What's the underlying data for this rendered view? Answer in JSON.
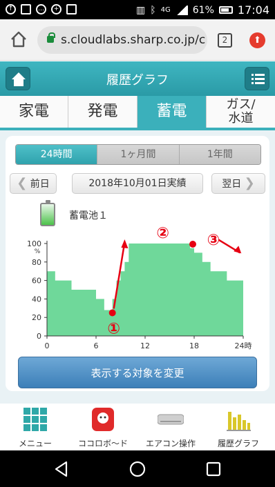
{
  "status_bar": {
    "battery": "61%",
    "time": "17:04",
    "network": "4G"
  },
  "browser": {
    "url": "s.cloudlabs.sharp.co.jp/c",
    "tab_count": "2"
  },
  "header": {
    "title": "履歴グラフ"
  },
  "tabs": [
    {
      "label": "家電",
      "active": false
    },
    {
      "label": "発電",
      "active": false
    },
    {
      "label": "蓄電",
      "active": true
    },
    {
      "label": "ガス/\n水道",
      "active": false
    }
  ],
  "range_tabs": [
    {
      "label": "24時間",
      "active": true
    },
    {
      "label": "1ヶ月間",
      "active": false
    },
    {
      "label": "1年間",
      "active": false
    }
  ],
  "date_nav": {
    "prev": "前日",
    "current": "2018年10月01日実績",
    "next": "翌日"
  },
  "device": {
    "label": "蓄電池１"
  },
  "chart_data": {
    "type": "area",
    "ylabel": "%",
    "ylim": [
      0,
      100
    ],
    "yticks": [
      0,
      20,
      40,
      60,
      80,
      100
    ],
    "xlim": [
      0,
      24
    ],
    "xticks": [
      0,
      6,
      12,
      18,
      24
    ],
    "xtick_labels": [
      "0",
      "6",
      "12",
      "18",
      "24時"
    ],
    "series": [
      {
        "color": "#6fd89a",
        "points": [
          [
            0,
            70
          ],
          [
            1,
            70
          ],
          [
            1,
            60
          ],
          [
            3,
            60
          ],
          [
            3,
            50
          ],
          [
            6,
            50
          ],
          [
            6,
            40
          ],
          [
            7,
            40
          ],
          [
            7,
            28
          ],
          [
            8,
            28
          ],
          [
            8,
            40
          ],
          [
            8.5,
            40
          ],
          [
            8.5,
            60
          ],
          [
            9,
            60
          ],
          [
            9,
            70
          ],
          [
            9.5,
            70
          ],
          [
            9.5,
            80
          ],
          [
            10,
            80
          ],
          [
            10,
            100
          ],
          [
            17.5,
            100
          ],
          [
            17.5,
            95
          ],
          [
            18,
            95
          ],
          [
            18,
            90
          ],
          [
            19,
            90
          ],
          [
            19,
            80
          ],
          [
            20,
            80
          ],
          [
            20,
            70
          ],
          [
            22,
            70
          ],
          [
            22,
            60
          ],
          [
            24,
            60
          ]
        ]
      }
    ],
    "annotations": [
      {
        "label": "①",
        "x": 8,
        "y": 28
      },
      {
        "label": "②",
        "x": 14,
        "y": 100
      },
      {
        "label": "③",
        "x": 18,
        "y": 100
      }
    ]
  },
  "change_button": "表示する対象を変更",
  "bottom_nav": [
    {
      "label": "メニュー",
      "icon": "menu-grid-icon"
    },
    {
      "label": "ココロボ～ド",
      "icon": "cocorobo-icon"
    },
    {
      "label": "エアコン操作",
      "icon": "aircon-icon"
    },
    {
      "label": "履歴グラフ",
      "icon": "history-graph-icon"
    }
  ],
  "colors": {
    "accent": "#3bb0bb",
    "chart_fill": "#6fd89a",
    "marker": "#e60012",
    "button": "#4a8cc4"
  }
}
